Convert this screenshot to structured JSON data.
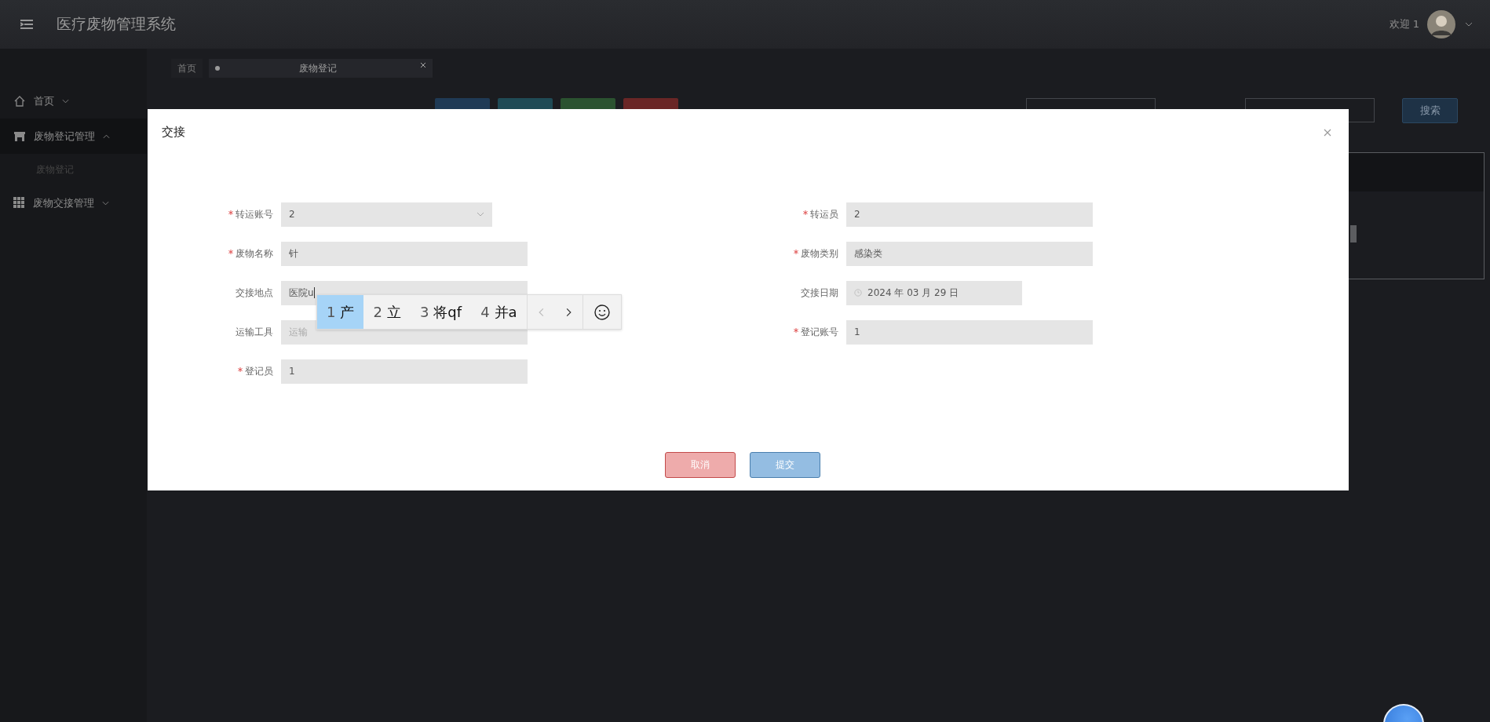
{
  "header": {
    "title": "医疗废物管理系统",
    "welcome": "欢迎 1"
  },
  "sidebar": {
    "items": [
      {
        "label": "首页",
        "expanded": false
      },
      {
        "label": "废物登记管理",
        "expanded": true,
        "children": [
          {
            "label": "废物登记"
          }
        ]
      },
      {
        "label": "废物交接管理",
        "expanded": false
      }
    ]
  },
  "tabs": [
    {
      "label": "首页",
      "closable": false,
      "selected": false
    },
    {
      "label": "废物登记",
      "closable": true,
      "selected": true
    }
  ],
  "toolbar": {
    "search_button": "搜索"
  },
  "dialog": {
    "title": "交接",
    "left_fields": [
      {
        "label": "转运账号",
        "required": true,
        "kind": "select",
        "value": "2"
      },
      {
        "label": "废物名称",
        "required": true,
        "kind": "text",
        "value": "针"
      },
      {
        "label": "交接地点",
        "required": false,
        "kind": "text",
        "value": "医院u",
        "focused": true
      },
      {
        "label": "运输工具",
        "required": false,
        "kind": "text",
        "placeholder": "运输"
      },
      {
        "label": "登记员",
        "required": true,
        "kind": "text",
        "value": "1"
      }
    ],
    "right_fields": [
      {
        "label": "转运员",
        "required": true,
        "kind": "text",
        "value": "2"
      },
      {
        "label": "废物类别",
        "required": true,
        "kind": "text",
        "value": "感染类"
      },
      {
        "label": "交接日期",
        "required": false,
        "kind": "date",
        "value": "2024 年 03 月 29 日"
      },
      {
        "label": "登记账号",
        "required": true,
        "kind": "text",
        "value": "1"
      }
    ],
    "buttons": [
      {
        "label": "取消",
        "kind": "cancel"
      },
      {
        "label": "提交",
        "kind": "submit"
      }
    ]
  },
  "ime": {
    "candidates": [
      {
        "number": "1",
        "text": "产",
        "selected": true
      },
      {
        "number": "2",
        "text": "立",
        "selected": false
      },
      {
        "number": "3",
        "text": "将qf",
        "selected": false
      },
      {
        "number": "4",
        "text": "并a",
        "selected": false
      }
    ]
  }
}
